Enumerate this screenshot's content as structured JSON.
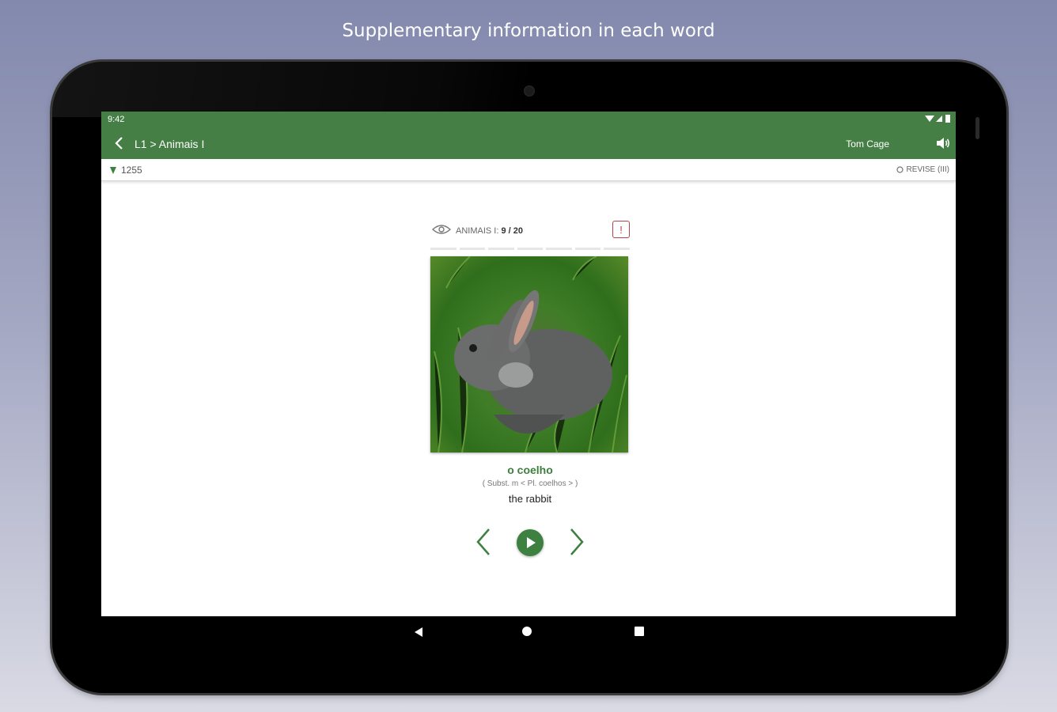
{
  "caption": "Supplementary information in each word",
  "status_bar": {
    "time": "9:42"
  },
  "app_bar": {
    "breadcrumb": "L1 > Animais I",
    "user_name": "Tom Cage"
  },
  "sub_bar": {
    "score": "1255",
    "revise_label": "REVISE (III)"
  },
  "card": {
    "lesson_label": "ANIMAIS I:",
    "lesson_position": "9 / 20",
    "report_label": "!",
    "progress_segments": 7,
    "image_subject": "rabbit",
    "word": "o coelho",
    "grammar": "( Subst. m < Pl. coelhos > )",
    "translation": "the rabbit"
  },
  "colors": {
    "accent": "#467f46",
    "report": "#b5434b"
  },
  "icons": {
    "back": "arrow-left-icon",
    "volume": "speaker-icon",
    "score": "gem-icon",
    "revise": "circle-icon",
    "eye": "eye-icon",
    "prev": "chevron-left-icon",
    "play": "play-icon",
    "next": "chevron-right-icon"
  }
}
